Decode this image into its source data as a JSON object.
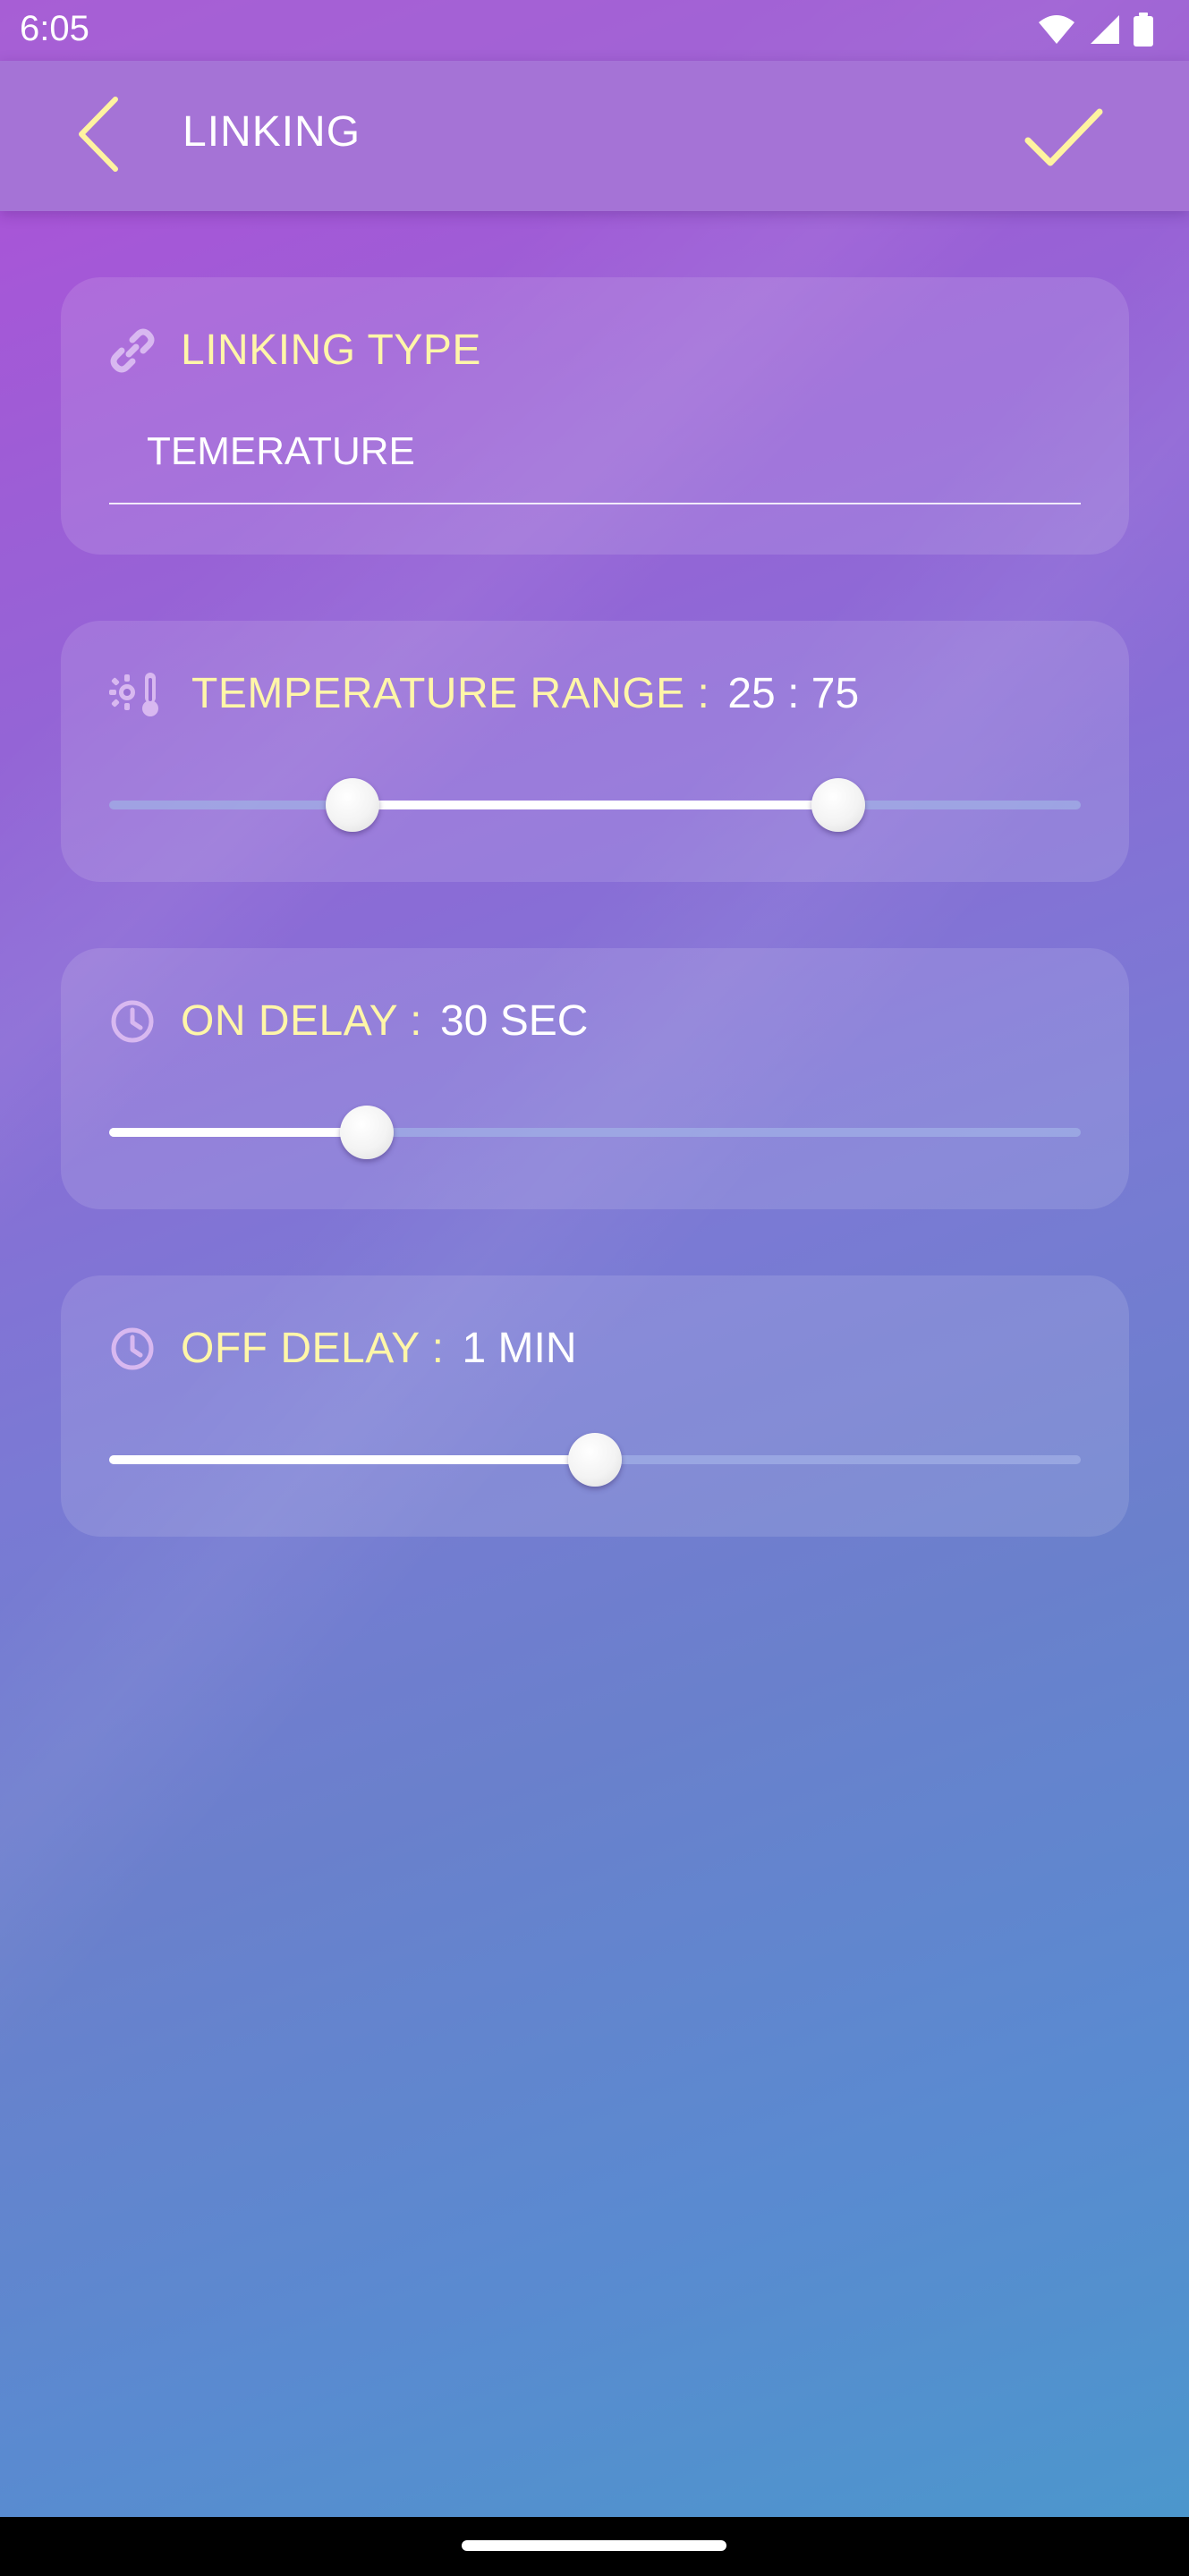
{
  "status_bar": {
    "time": "6:05",
    "icons": [
      "wifi-icon",
      "signal-icon",
      "battery-icon"
    ]
  },
  "app_bar": {
    "title": "LINKING",
    "back_icon": "chevron-left-icon",
    "confirm_icon": "check-icon"
  },
  "linking_type": {
    "icon": "link-icon",
    "label": "LINKING TYPE",
    "value": "TEMERATURE"
  },
  "temperature_range": {
    "icon": "thermostat-icon",
    "label": "TEMPERATURE RANGE :",
    "value": "25 : 75",
    "slider": {
      "min": 0,
      "max": 100,
      "low": 25,
      "high": 75
    }
  },
  "on_delay": {
    "icon": "clock-icon",
    "label": "ON DELAY :",
    "value": "30 SEC",
    "slider": {
      "fraction": 0.265
    }
  },
  "off_delay": {
    "icon": "clock-icon",
    "label": "OFF DELAY :",
    "value": "1 MIN",
    "slider": {
      "fraction": 0.5
    }
  },
  "colors": {
    "label_yellow": "#fff6a8",
    "app_bar": "#a573d6",
    "check_yellow": "#fff3a0"
  }
}
